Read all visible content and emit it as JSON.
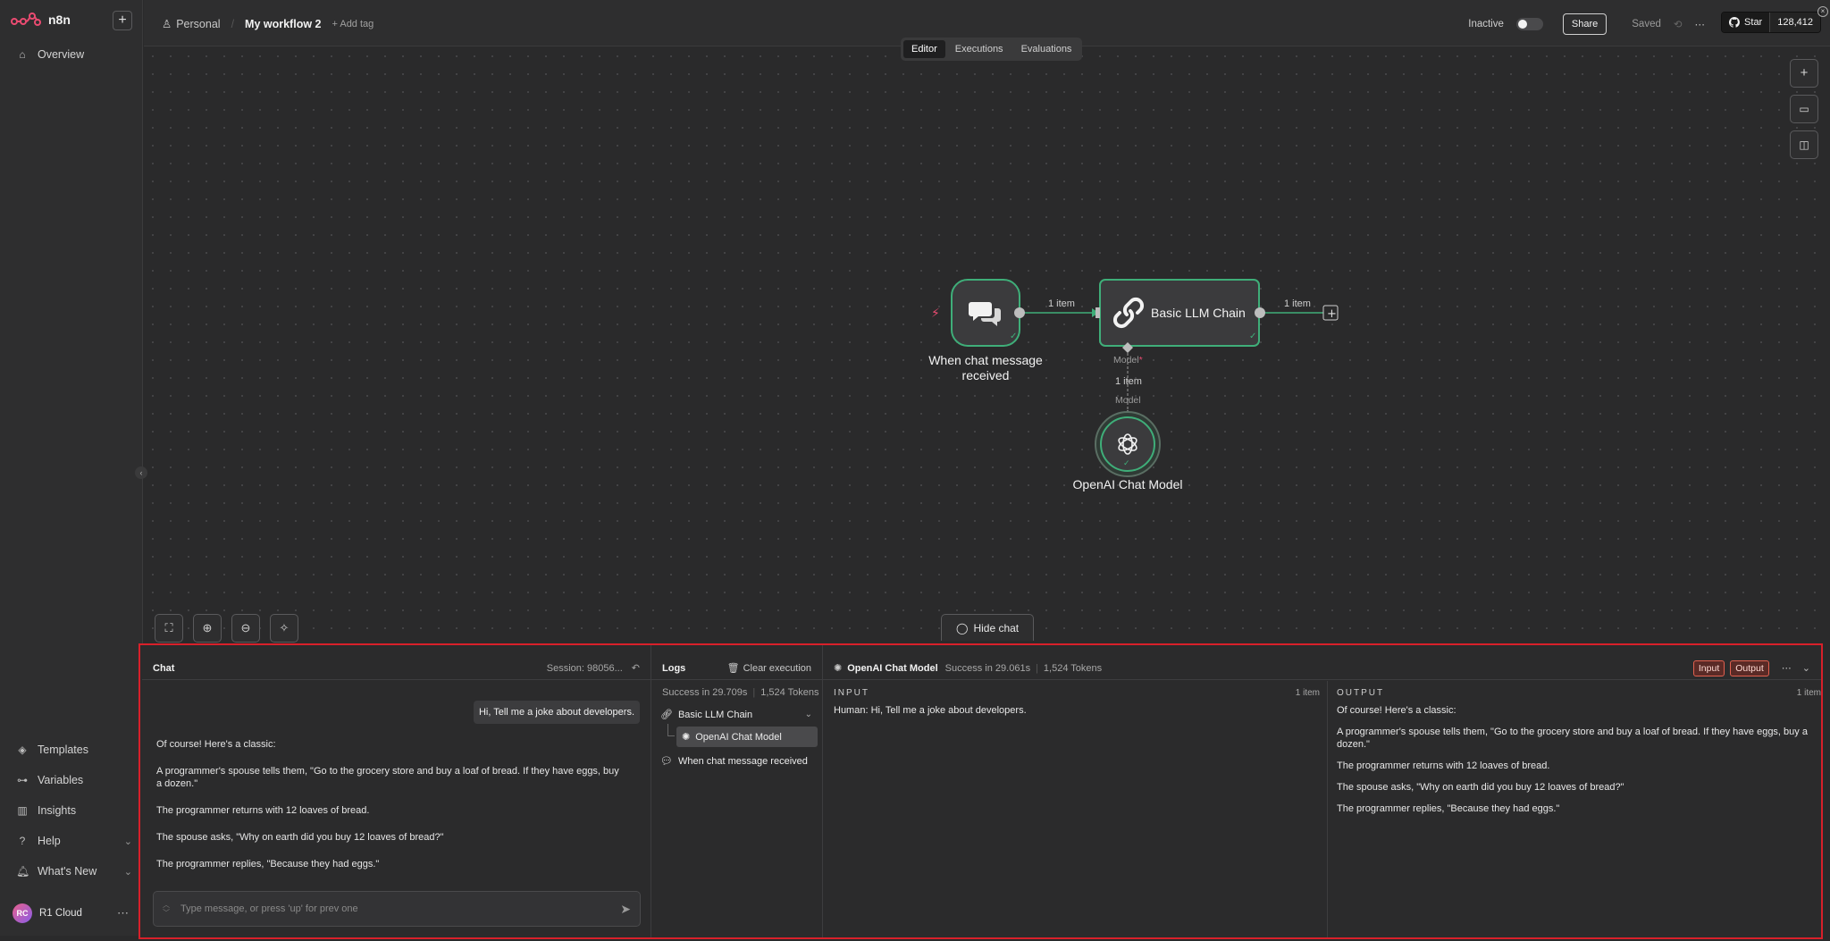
{
  "app": {
    "name": "n8n"
  },
  "sidebar": {
    "overview": "Overview",
    "bottom_items": [
      {
        "label": "Templates",
        "icon": "templates-icon"
      },
      {
        "label": "Variables",
        "icon": "variables-icon"
      },
      {
        "label": "Insights",
        "icon": "insights-icon"
      },
      {
        "label": "Help",
        "icon": "help-icon"
      },
      {
        "label": "What's New",
        "icon": "bell-icon"
      }
    ],
    "user": {
      "initials": "RC",
      "name": "R1 Cloud"
    }
  },
  "header": {
    "project": "Personal",
    "workflow_name": "My workflow 2",
    "add_tag": "+ Add tag",
    "status": "Inactive",
    "share": "Share",
    "saved": "Saved",
    "github_star": "Star",
    "github_count": "128,412"
  },
  "tabs": [
    "Editor",
    "Executions",
    "Evaluations"
  ],
  "canvas": {
    "nodes": {
      "trigger": {
        "label_line1": "When chat message",
        "label_line2": "received"
      },
      "chain": {
        "label": "Basic LLM Chain"
      },
      "model": {
        "label": "OpenAI Chat Model"
      }
    },
    "edges": {
      "trigger_to_chain": "1 item",
      "chain_out": "1 item",
      "model_to_chain": "1 item"
    },
    "ports": {
      "model_top": "Model",
      "model_required": "*",
      "model_bottom": "Model"
    },
    "hide_chat": "Hide chat"
  },
  "panel": {
    "chat": {
      "title": "Chat",
      "session": "Session: 98056...",
      "user_message": "Hi, Tell me a joke about developers.",
      "bot_message": [
        "Of course! Here's a classic:",
        "A programmer's spouse tells them, \"Go to the grocery store and buy a loaf of bread. If they have eggs, buy a dozen.\"",
        "The programmer returns with 12 loaves of bread.",
        "The spouse asks, \"Why on earth did you buy 12 loaves of bread?\"",
        "The programmer replies, \"Because they had eggs.\""
      ],
      "input_placeholder": "Type message, or press 'up' for prev one"
    },
    "logs": {
      "title": "Logs",
      "clear": "Clear execution",
      "success": "Success in 29.709s",
      "tokens": "1,524 Tokens",
      "tree": [
        "Basic LLM Chain",
        "OpenAI Chat Model",
        "When chat message received"
      ]
    },
    "node": {
      "name": "OpenAI Chat Model",
      "success": "Success in 29.061s",
      "tokens": "1,524 Tokens",
      "input_btn": "Input",
      "output_btn": "Output"
    },
    "input": {
      "label": "INPUT",
      "count": "1 item",
      "text": "Human: Hi, Tell me a joke about developers."
    },
    "output": {
      "label": "OUTPUT",
      "count": "1 item",
      "lines": [
        "Of course! Here's a classic:",
        "A programmer's spouse tells them, \"Go to the grocery store and buy a loaf of bread. If they have eggs, buy a dozen.\"",
        "The programmer returns with 12 loaves of bread.",
        "The spouse asks, \"Why on earth did you buy 12 loaves of bread?\"",
        "The programmer replies, \"Because they had eggs.\""
      ]
    }
  },
  "colors": {
    "accent_node_border": "#3fae79",
    "brand": "#ea4b71",
    "highlight_border": "#d8202a"
  }
}
